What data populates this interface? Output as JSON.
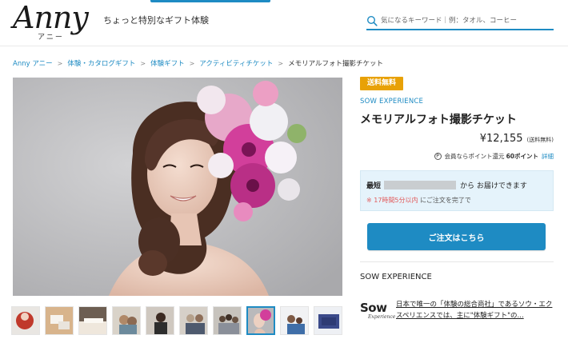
{
  "header": {
    "logo_text": "Anny",
    "logo_kana": "アニー",
    "tagline": "ちょっと特別なギフト体験",
    "search_placeholder": "気になるキーワード｜例：タオル、コーヒー"
  },
  "breadcrumb": {
    "items": [
      "Anny アニー",
      "体験・カタログギフト",
      "体験ギフト",
      "アクティビティチケット"
    ],
    "current": "メモリアルフォト撮影チケット"
  },
  "product": {
    "badge": "送料無料",
    "brand": "SOW EXPERIENCE",
    "title": "メモリアルフォト撮影チケット",
    "price": "¥12,155",
    "price_note": "(送料無料)",
    "points_icon": "P",
    "points_text": "会員ならポイント還元",
    "points_value": "60ポイント",
    "points_link": "詳細"
  },
  "delivery": {
    "prefix": "最短",
    "suffix": "から お届けできます",
    "notice_prefix": "※",
    "notice_time": "17時間5分以内",
    "notice_suffix": "にご注文を完了で"
  },
  "order_button": "ご注文はこちら",
  "seller": {
    "section_title": "SOW EXPERIENCE",
    "logo_word": "Sow",
    "logo_sub": "Experience",
    "description": "日本で唯一の「体験の総合商社」であるソウ・エクスペリエンスでは、主に\"体験ギフト\"の..."
  },
  "thumbnails": {
    "count": 10,
    "active_index": 7,
    "colors": [
      "#c0392b",
      "#d8b48c",
      "#efe7dc",
      "#b08968",
      "#8c7a6b",
      "#b5a08a",
      "#c7c3bd",
      "#9aa3ad",
      "#e3e6ea",
      "#3b4a8a"
    ]
  },
  "colors": {
    "accent": "#1e8bc3",
    "badge": "#e8a106",
    "alert": "#e25a5a"
  }
}
